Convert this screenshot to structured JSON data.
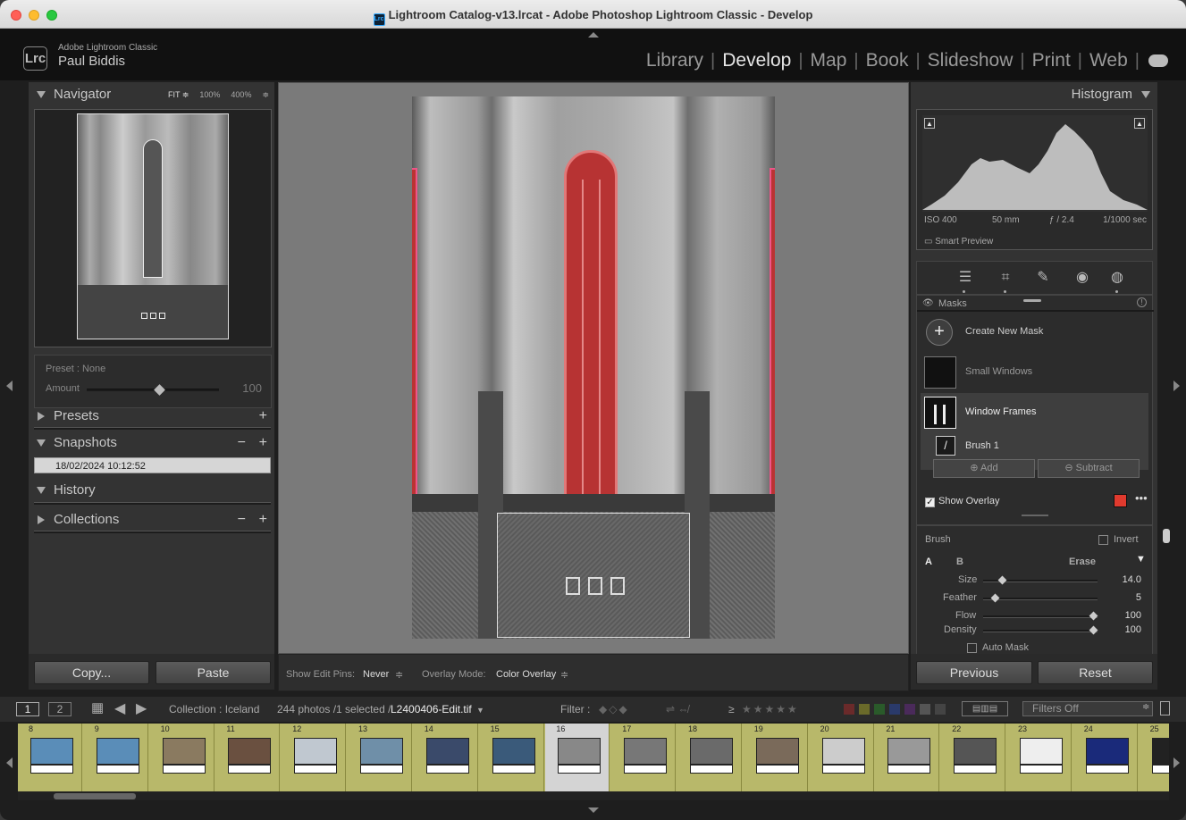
{
  "window": {
    "title": "Lightroom Catalog-v13.lrcat - Adobe Photoshop Lightroom Classic - Develop",
    "app_icon": "Lrc"
  },
  "identity": {
    "app_name": "Adobe Lightroom Classic",
    "user": "Paul Biddis",
    "logo": "Lrc"
  },
  "modules": [
    {
      "label": "Library",
      "active": false
    },
    {
      "label": "Develop",
      "active": true
    },
    {
      "label": "Map",
      "active": false
    },
    {
      "label": "Book",
      "active": false
    },
    {
      "label": "Slideshow",
      "active": false
    },
    {
      "label": "Print",
      "active": false
    },
    {
      "label": "Web",
      "active": false
    }
  ],
  "left_panel": {
    "navigator": {
      "title": "Navigator",
      "zoom_fit": "FIT ≑",
      "zoom_100": "100%",
      "zoom_400": "400%"
    },
    "preset": {
      "label": "Preset : None",
      "amount_label": "Amount",
      "amount_value": "100",
      "amount_fraction": 0.55
    },
    "presets": {
      "title": "Presets"
    },
    "snapshots": {
      "title": "Snapshots",
      "items": [
        "18/02/2024 10:12:52"
      ]
    },
    "history": {
      "title": "History"
    },
    "collections": {
      "title": "Collections"
    },
    "copy_button": "Copy...",
    "paste_button": "Paste"
  },
  "center_toolbar": {
    "show_pins_label": "Show Edit Pins:",
    "show_pins_value": "Never",
    "overlay_mode_label": "Overlay Mode:",
    "overlay_mode_value": "Color Overlay"
  },
  "right_panel": {
    "histogram": {
      "title": "Histogram",
      "iso": "ISO 400",
      "focal": "50 mm",
      "aperture": "ƒ / 2.4",
      "shutter": "1/1000 sec",
      "smart_preview": "Smart Preview"
    },
    "masks": {
      "title": "Masks",
      "create_new": "Create New Mask",
      "items": [
        {
          "label": "Small Windows",
          "selected": false
        },
        {
          "label": "Window Frames",
          "selected": true
        }
      ],
      "component": "Brush 1",
      "add_label": "Add",
      "subtract_label": "Subtract",
      "show_overlay_label": "Show Overlay",
      "overlay_color": "#e03a2e"
    },
    "brush": {
      "title": "Brush",
      "invert_label": "Invert",
      "tab_a": "A",
      "tab_b": "B",
      "erase_label": "Erase",
      "sliders": [
        {
          "label": "Size",
          "value": "14.0",
          "fraction": 0.15
        },
        {
          "label": "Feather",
          "value": "5",
          "fraction": 0.08
        },
        {
          "label": "Flow",
          "value": "100",
          "fraction": 1.0
        },
        {
          "label": "Density",
          "value": "100",
          "fraction": 1.0
        }
      ],
      "auto_mask_label": "Auto Mask"
    },
    "previous_button": "Previous",
    "reset_button": "Reset"
  },
  "filmstrip_bar": {
    "view1": "1",
    "view2": "2",
    "collection": "Collection : Iceland",
    "count": "244 photos /1 selected /",
    "filename": "L2400406-Edit.tif",
    "filter_label": "Filter :",
    "rating_ge": "≥",
    "filters_off": "Filters Off"
  },
  "filmstrip": {
    "numbers": [
      "8",
      "9",
      "10",
      "11",
      "12",
      "13",
      "14",
      "15",
      "16",
      "17",
      "18",
      "19",
      "20",
      "21",
      "22",
      "23",
      "24",
      "25"
    ],
    "selected": "16"
  }
}
